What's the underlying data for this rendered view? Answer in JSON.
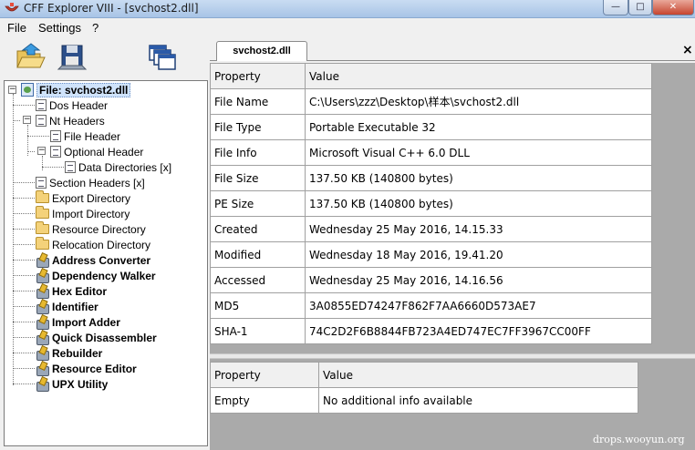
{
  "window": {
    "title": "CFF Explorer VIII - [svchost2.dll]",
    "minimize": "—",
    "maximize": "□",
    "close": "✕"
  },
  "menu": [
    "File",
    "Settings",
    "?"
  ],
  "toolbar": {
    "buttons": [
      {
        "icon": "open-folder-icon"
      },
      {
        "icon": "save-disk-icon"
      },
      {
        "icon": "windows-icon"
      }
    ]
  },
  "tree": {
    "root": "File: svchost2.dll",
    "items": [
      {
        "label": "Dos Header",
        "icon": "header-icon",
        "bold": false
      },
      {
        "label": "Nt Headers",
        "icon": "header-icon",
        "bold": false
      },
      {
        "label": "File Header",
        "icon": "header-icon",
        "bold": false
      },
      {
        "label": "Optional Header",
        "icon": "header-icon",
        "bold": false
      },
      {
        "label": "Data Directories [x]",
        "icon": "header-icon",
        "bold": false
      },
      {
        "label": "Section Headers [x]",
        "icon": "header-icon",
        "bold": false
      },
      {
        "label": "Export Directory",
        "icon": "folder-icon",
        "bold": false
      },
      {
        "label": "Import Directory",
        "icon": "folder-icon",
        "bold": false
      },
      {
        "label": "Resource Directory",
        "icon": "folder-icon",
        "bold": false
      },
      {
        "label": "Relocation Directory",
        "icon": "folder-icon",
        "bold": false
      },
      {
        "label": "Address Converter",
        "icon": "tool-icon",
        "bold": true
      },
      {
        "label": "Dependency Walker",
        "icon": "tool-icon",
        "bold": true
      },
      {
        "label": "Hex Editor",
        "icon": "tool-icon",
        "bold": true
      },
      {
        "label": "Identifier",
        "icon": "tool-icon",
        "bold": true
      },
      {
        "label": "Import Adder",
        "icon": "tool-icon",
        "bold": true
      },
      {
        "label": "Quick Disassembler",
        "icon": "tool-icon",
        "bold": true
      },
      {
        "label": "Rebuilder",
        "icon": "tool-icon",
        "bold": true
      },
      {
        "label": "Resource Editor",
        "icon": "tool-icon",
        "bold": true
      },
      {
        "label": "UPX Utility",
        "icon": "tool-icon",
        "bold": true
      }
    ]
  },
  "tab": {
    "label": "svchost2.dll",
    "close": "×"
  },
  "main_table": {
    "headers": [
      "Property",
      "Value"
    ],
    "rows": [
      [
        "File Name",
        "C:\\Users\\zzz\\Desktop\\样本\\svchost2.dll"
      ],
      [
        "File Type",
        "Portable Executable 32"
      ],
      [
        "File Info",
        "Microsoft Visual C++ 6.0 DLL"
      ],
      [
        "File Size",
        "137.50 KB (140800 bytes)"
      ],
      [
        "PE Size",
        "137.50 KB (140800 bytes)"
      ],
      [
        "Created",
        "Wednesday 25 May 2016, 14.15.33"
      ],
      [
        "Modified",
        "Wednesday 18 May 2016, 19.41.20"
      ],
      [
        "Accessed",
        "Wednesday 25 May 2016, 14.16.56"
      ],
      [
        "MD5",
        "3A0855ED74247F862F7AA6660D573AE7"
      ],
      [
        "SHA-1",
        "74C2D2F6B8844FB723A4ED747EC7FF3967CC00FF"
      ]
    ]
  },
  "info_table": {
    "headers": [
      "Property",
      "Value"
    ],
    "rows": [
      [
        "Empty",
        "No additional info available"
      ]
    ]
  },
  "watermark": "drops.wooyun.org"
}
